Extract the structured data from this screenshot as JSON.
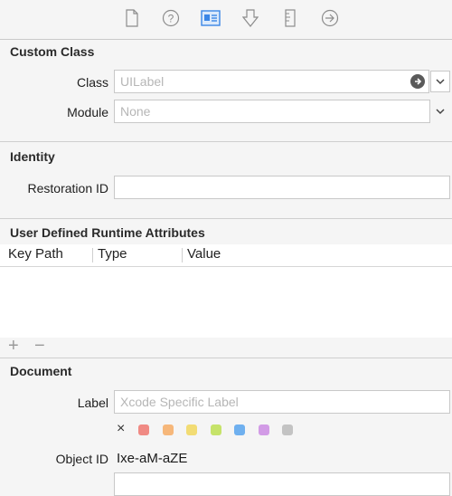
{
  "toolbar": {
    "icons": [
      "file-inspector-icon",
      "quick-help-icon",
      "identity-inspector-icon",
      "attributes-inspector-icon",
      "size-inspector-icon",
      "connections-inspector-icon"
    ]
  },
  "custom_class": {
    "header": "Custom Class",
    "class_label": "Class",
    "class_value": "UILabel",
    "module_label": "Module",
    "module_value": "None"
  },
  "identity": {
    "header": "Identity",
    "restoration_label": "Restoration ID",
    "restoration_value": ""
  },
  "runtime_attributes": {
    "header": "User Defined Runtime Attributes",
    "columns": [
      "Key Path",
      "Type",
      "Value"
    ],
    "add_symbol": "+",
    "remove_symbol": "−"
  },
  "document": {
    "header": "Document",
    "label_label": "Label",
    "label_placeholder": "Xcode Specific Label",
    "clear_symbol": "×",
    "colors": [
      "#f08a84",
      "#f6b77a",
      "#f2dc74",
      "#c6e36a",
      "#6fb0ef",
      "#d29be6",
      "#c3c3c3"
    ],
    "object_id_label": "Object ID",
    "object_id_value": "Ixe-aM-aZE"
  },
  "accent": "#3b86e6"
}
